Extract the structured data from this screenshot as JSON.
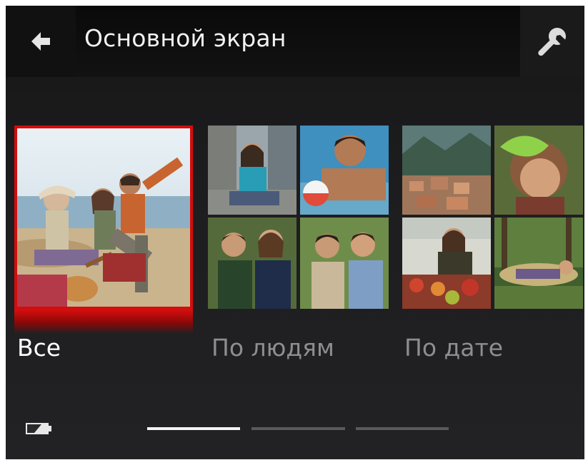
{
  "header": {
    "title": "Основной экран",
    "back_icon": "back-arrow-icon",
    "settings_icon": "wrench-icon"
  },
  "albums": [
    {
      "label": "Все",
      "selected": true
    },
    {
      "label": "По людям",
      "selected": false
    },
    {
      "label": "По дате",
      "selected": false
    }
  ],
  "status": {
    "battery_icon": "battery-icon"
  },
  "pager": {
    "pages": 3,
    "active_page": 1
  },
  "colors": {
    "accent": "#d40c0c",
    "background": "#1d1d1f",
    "text_primary": "#ffffff",
    "text_secondary": "#8e8e90"
  }
}
